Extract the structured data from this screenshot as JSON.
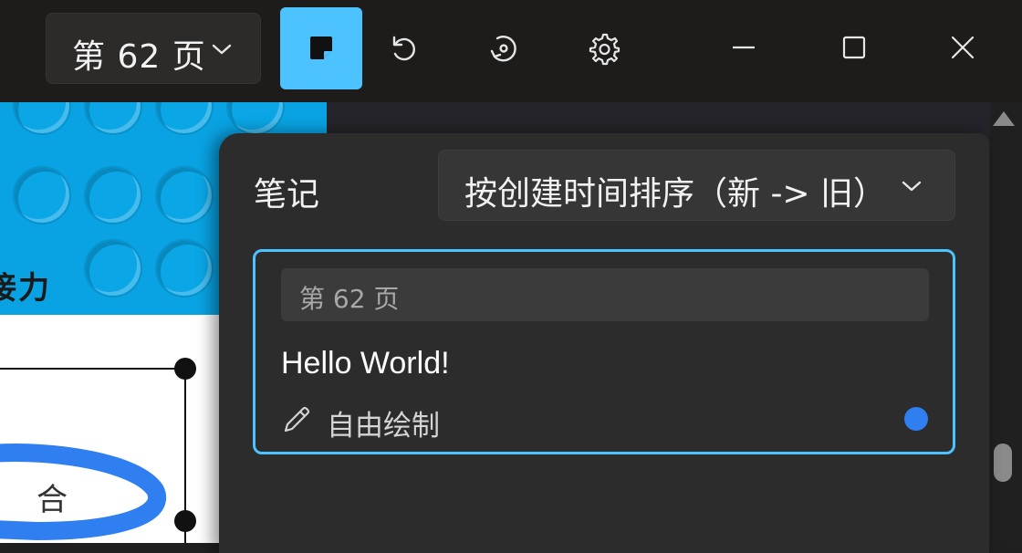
{
  "titlebar": {
    "page_selector": {
      "label": "第 62 页",
      "icon": "chevron-down-icon"
    },
    "buttons": [
      {
        "name": "notes-button",
        "icon": "sticky-note-icon",
        "active": true
      },
      {
        "name": "undo-button",
        "icon": "undo-icon"
      },
      {
        "name": "redo-button",
        "icon": "rotate-icon"
      },
      {
        "name": "settings-button",
        "icon": "gear-icon"
      }
    ],
    "window_controls": [
      "minimize-icon",
      "maximize-icon",
      "close-icon"
    ]
  },
  "document": {
    "visible_text": "接力",
    "visible_char": "合"
  },
  "notes_panel": {
    "title": "笔记",
    "sort": {
      "value": "按创建时间排序（新 -> 旧）",
      "icon": "chevron-down-icon"
    },
    "notes": [
      {
        "page": "第 62 页",
        "content": "Hello World!",
        "type_label": "自由绘制",
        "type_icon": "pencil-icon",
        "color": "#2f7ff0",
        "selected": true
      }
    ]
  },
  "colors": {
    "accent": "#4cc2ff",
    "note_dot": "#2f7ff0",
    "panel_bg": "#2c2c2c",
    "titlebar_bg": "#1d1c1b"
  }
}
